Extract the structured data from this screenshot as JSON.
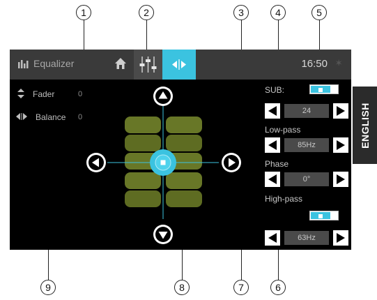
{
  "callouts": [
    "1",
    "2",
    "3",
    "4",
    "5",
    "6",
    "7",
    "8",
    "9"
  ],
  "header": {
    "title": "Equalizer",
    "time": "16:50",
    "icons": [
      "equalizer-icon",
      "home-icon",
      "mixer-icon",
      "balance-icon",
      "bluetooth-icon"
    ]
  },
  "left": {
    "fader_label": "Fader",
    "fader_value": "0",
    "balance_label": "Balance",
    "balance_value": "0"
  },
  "right": {
    "sub_label": "SUB:",
    "sub_on": true,
    "sub_value": "24",
    "lowpass_label": "Low-pass",
    "lowpass_value": "85Hz",
    "phase_label": "Phase",
    "phase_value": "0°",
    "highpass_label": "High-pass",
    "highpass_on": true,
    "highpass_value": "63Hz"
  },
  "side_tab": "ENGLISH",
  "colors": {
    "accent": "#3bc3e0",
    "speaker": "#7a8c2e",
    "bar": "#3a3a3a"
  }
}
